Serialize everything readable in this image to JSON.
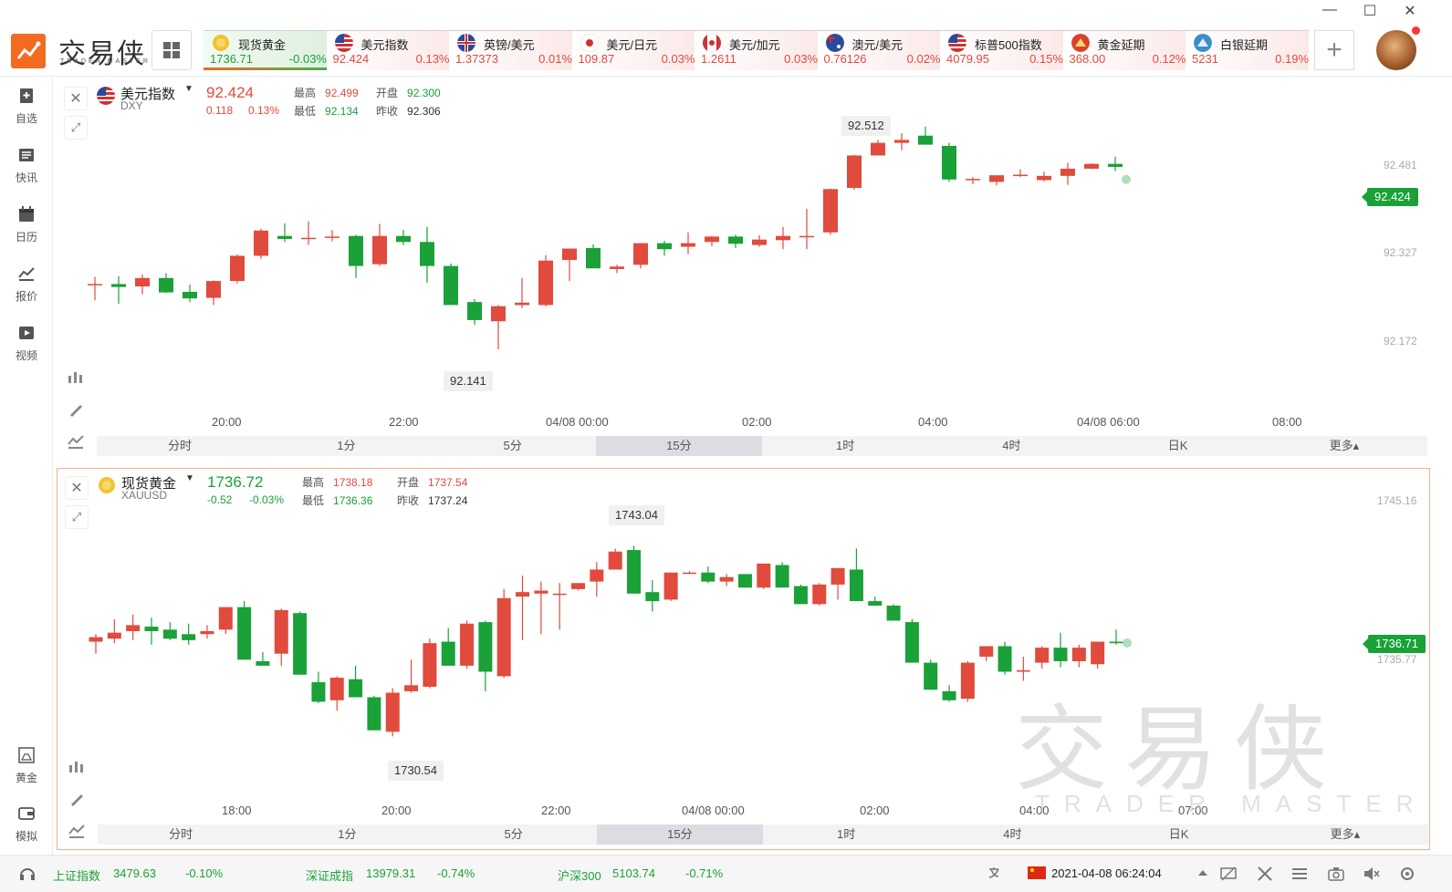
{
  "app": {
    "brand_cn": "交易侠",
    "brand_en": "TRADER MASTER",
    "win": {
      "min": "—",
      "max": "☐",
      "close": "✕"
    }
  },
  "tabs": [
    {
      "name": "现货黄金",
      "price": "1736.71",
      "pct": "-0.03%",
      "dir": "down",
      "flag": "gold-coin-icon"
    },
    {
      "name": "美元指数",
      "price": "92.424",
      "pct": "0.13%",
      "dir": "up",
      "flag": "us-flag-icon"
    },
    {
      "name": "英镑/美元",
      "price": "1.37373",
      "pct": "0.01%",
      "dir": "up",
      "flag": "uk-flag-icon"
    },
    {
      "name": "美元/日元",
      "price": "109.87",
      "pct": "0.03%",
      "dir": "up",
      "flag": "jp-flag-icon"
    },
    {
      "name": "美元/加元",
      "price": "1.2611",
      "pct": "0.03%",
      "dir": "up",
      "flag": "ca-flag-icon"
    },
    {
      "name": "澳元/美元",
      "price": "0.76126",
      "pct": "0.02%",
      "dir": "up",
      "flag": "au-flag-icon"
    },
    {
      "name": "标普500指数",
      "price": "4079.95",
      "pct": "0.15%",
      "dir": "up",
      "flag": "us-flag-icon"
    },
    {
      "name": "黄金延期",
      "price": "368.00",
      "pct": "0.12%",
      "dir": "up",
      "flag": "sge-gold-icon"
    },
    {
      "name": "白银延期",
      "price": "5231",
      "pct": "0.19%",
      "dir": "up",
      "flag": "sge-silver-icon"
    }
  ],
  "sidebar": [
    {
      "label": "自选",
      "icon": "bookmark-plus-icon"
    },
    {
      "label": "快讯",
      "icon": "news-list-icon"
    },
    {
      "label": "日历",
      "icon": "calendar-icon"
    },
    {
      "label": "报价",
      "icon": "line-chart-icon"
    },
    {
      "label": "视频",
      "icon": "video-play-icon"
    },
    {
      "label": "黄金",
      "icon": "gold-bars-icon"
    },
    {
      "label": "模拟",
      "icon": "wallet-icon"
    }
  ],
  "panel1": {
    "name": "美元指数",
    "code": "DXY",
    "price": "92.424",
    "chg": "0.118",
    "chgpct": "0.13%",
    "high_k": "最高",
    "high": "92.499",
    "open_k": "开盘",
    "open": "92.300",
    "low_k": "最低",
    "low": "92.134",
    "prev_k": "昨收",
    "prev": "92.306",
    "last_tag": "92.424",
    "yticks": [
      "92.481",
      "92.327",
      "92.172"
    ],
    "max_bubble": "92.512",
    "min_bubble": "92.141",
    "xticks": [
      "20:00",
      "22:00",
      "04/08 00:00",
      "02:00",
      "04:00",
      "04/08 06:00",
      "08:00"
    ]
  },
  "panel2": {
    "name": "现货黄金",
    "code": "XAUUSD",
    "price": "1736.72",
    "chg": "-0.52",
    "chgpct": "-0.03%",
    "high_k": "最高",
    "high": "1738.18",
    "open_k": "开盘",
    "open": "1737.54",
    "low_k": "最低",
    "low": "1736.36",
    "prev_k": "昨收",
    "prev": "1737.24",
    "last_tag": "1736.71",
    "yticks": [
      "1745.16",
      "1735.77"
    ],
    "max_bubble": "1743.04",
    "min_bubble": "1730.54",
    "xticks": [
      "18:00",
      "20:00",
      "22:00",
      "04/08 00:00",
      "02:00",
      "04:00",
      "07:00"
    ]
  },
  "timeframes": [
    "分时",
    "1分",
    "5分",
    "15分",
    "1时",
    "4时",
    "日K",
    "更多▴"
  ],
  "selected_timeframe": "15分",
  "watermark": {
    "cn": "交易侠",
    "en": "TRADER MASTER"
  },
  "status": {
    "idx1_name": "上证指数",
    "idx1_val": "3479.63",
    "idx1_pct": "-0.10%",
    "idx2_name": "深证成指",
    "idx2_val": "13979.31",
    "idx2_pct": "-0.74%",
    "idx3_name": "沪深300",
    "idx3_val": "5103.74",
    "idx3_pct": "-0.71%",
    "datetime": "2021-04-08 06:24:04"
  },
  "colors": {
    "up": "#e04b3d",
    "down": "#1aa138",
    "brand": "#f26b21"
  },
  "chart_data": [
    {
      "type": "candlestick",
      "title": "美元指数 DXY",
      "interval": "15分",
      "x": [
        "19:30",
        "19:45",
        "20:00",
        "20:15",
        "20:30",
        "20:45",
        "21:00",
        "21:15",
        "21:30",
        "21:45",
        "22:00",
        "22:15",
        "22:30",
        "22:45",
        "23:00",
        "23:15",
        "23:30",
        "23:45",
        "00:00",
        "00:15",
        "00:30",
        "00:45",
        "01:00",
        "01:15",
        "01:30",
        "01:45",
        "02:00",
        "02:15",
        "02:30",
        "02:45",
        "03:00",
        "03:15",
        "03:30",
        "03:45",
        "04:00",
        "04:15",
        "04:30",
        "04:45",
        "05:00",
        "05:15",
        "05:30",
        "05:45",
        "06:00",
        "06:15"
      ],
      "ohlc": [
        [
          92.249,
          92.262,
          92.223,
          92.25
        ],
        [
          92.25,
          92.263,
          92.217,
          92.245
        ],
        [
          92.246,
          92.266,
          92.233,
          92.26
        ],
        [
          92.26,
          92.268,
          92.235,
          92.236
        ],
        [
          92.237,
          92.249,
          92.22,
          92.226
        ],
        [
          92.227,
          92.256,
          92.215,
          92.255
        ],
        [
          92.255,
          92.299,
          92.251,
          92.297
        ],
        [
          92.297,
          92.342,
          92.292,
          92.339
        ],
        [
          92.33,
          92.351,
          92.32,
          92.325
        ],
        [
          92.326,
          92.354,
          92.315,
          92.327
        ],
        [
          92.329,
          92.34,
          92.321,
          92.329
        ],
        [
          92.33,
          92.332,
          92.26,
          92.28
        ],
        [
          92.283,
          92.35,
          92.28,
          92.33
        ],
        [
          92.33,
          92.34,
          92.315,
          92.32
        ],
        [
          92.32,
          92.345,
          92.252,
          92.28
        ],
        [
          92.28,
          92.284,
          92.219,
          92.215
        ],
        [
          92.22,
          92.225,
          92.182,
          92.19
        ],
        [
          92.188,
          92.215,
          92.141,
          92.213
        ],
        [
          92.215,
          92.26,
          92.21,
          92.219
        ],
        [
          92.215,
          92.298,
          92.213,
          92.289
        ],
        [
          92.29,
          92.298,
          92.255,
          92.309
        ],
        [
          92.31,
          92.316,
          92.279,
          92.276
        ],
        [
          92.275,
          92.282,
          92.268,
          92.279
        ],
        [
          92.282,
          92.318,
          92.276,
          92.318
        ],
        [
          92.318,
          92.322,
          92.297,
          92.308
        ],
        [
          92.312,
          92.336,
          92.3,
          92.318
        ],
        [
          92.32,
          92.33,
          92.313,
          92.329
        ],
        [
          92.329,
          92.332,
          92.31,
          92.317
        ],
        [
          92.315,
          92.331,
          92.312,
          92.324
        ],
        [
          92.323,
          92.345,
          92.308,
          92.33
        ],
        [
          92.33,
          92.375,
          92.308,
          92.33
        ],
        [
          92.336,
          92.409,
          92.332,
          92.408
        ],
        [
          92.41,
          92.465,
          92.407,
          92.464
        ],
        [
          92.464,
          92.49,
          92.469,
          92.485
        ],
        [
          92.485,
          92.501,
          92.473,
          92.49
        ],
        [
          92.497,
          92.512,
          92.486,
          92.482
        ],
        [
          92.48,
          92.485,
          92.42,
          92.424
        ],
        [
          92.423,
          92.428,
          92.416,
          92.425
        ],
        [
          92.42,
          92.43,
          92.414,
          92.431
        ],
        [
          92.43,
          92.441,
          92.428,
          92.432
        ],
        [
          92.423,
          92.437,
          92.421,
          92.43
        ],
        [
          92.43,
          92.452,
          92.415,
          92.442
        ],
        [
          92.442,
          92.451,
          92.441,
          92.45
        ],
        [
          92.45,
          92.462,
          92.438,
          92.445
        ]
      ],
      "ylim": [
        92.12,
        92.53
      ],
      "last_price": 92.424,
      "grid": false
    },
    {
      "type": "candlestick",
      "title": "现货黄金 XAUUSD",
      "interval": "15分",
      "x": [
        "17:30",
        "17:45",
        "18:00",
        "18:15",
        "18:30",
        "18:45",
        "19:00",
        "19:15",
        "19:30",
        "19:45",
        "20:00",
        "20:15",
        "20:30",
        "20:45",
        "21:00",
        "21:15",
        "21:30",
        "21:45",
        "22:00",
        "22:15",
        "22:30",
        "22:45",
        "23:00",
        "23:15",
        "23:30",
        "23:45",
        "00:00",
        "00:15",
        "00:30",
        "00:45",
        "01:00",
        "01:15",
        "01:30",
        "01:45",
        "02:00",
        "02:15",
        "02:30",
        "02:45",
        "03:00",
        "03:15",
        "03:30",
        "03:45",
        "04:00",
        "04:15",
        "04:30",
        "04:45",
        "05:00",
        "05:15",
        "05:30",
        "05:45",
        "06:00"
      ],
      "ohlc": [
        [
          1736.8,
          1737.3,
          1736.0,
          1737.1
        ],
        [
          1737.0,
          1738.3,
          1736.7,
          1737.4
        ],
        [
          1737.5,
          1738.6,
          1736.9,
          1737.9
        ],
        [
          1737.8,
          1738.4,
          1736.6,
          1737.5
        ],
        [
          1737.6,
          1738.1,
          1736.9,
          1737.0
        ],
        [
          1737.3,
          1738.0,
          1736.6,
          1736.9
        ],
        [
          1737.3,
          1737.9,
          1737.0,
          1737.5
        ],
        [
          1737.6,
          1739.1,
          1737.3,
          1739.1
        ],
        [
          1739.1,
          1739.5,
          1735.6,
          1735.6
        ],
        [
          1735.5,
          1736.1,
          1735.3,
          1735.2
        ],
        [
          1736.0,
          1739.0,
          1735.2,
          1738.9
        ],
        [
          1738.7,
          1738.8,
          1734.6,
          1734.6
        ],
        [
          1734.1,
          1734.8,
          1732.7,
          1732.8
        ],
        [
          1732.9,
          1734.5,
          1732.2,
          1734.4
        ],
        [
          1734.3,
          1735.2,
          1733.2,
          1733.1
        ],
        [
          1733.1,
          1733.2,
          1730.9,
          1730.9
        ],
        [
          1730.8,
          1733.7,
          1730.5,
          1733.4
        ],
        [
          1733.5,
          1735.6,
          1733.4,
          1733.9
        ],
        [
          1733.8,
          1737.0,
          1733.7,
          1736.7
        ],
        [
          1736.8,
          1737.7,
          1735.2,
          1735.2
        ],
        [
          1735.2,
          1738.2,
          1735.0,
          1738.0
        ],
        [
          1738.1,
          1738.2,
          1733.5,
          1734.8
        ],
        [
          1734.5,
          1740.3,
          1734.4,
          1739.7
        ],
        [
          1739.8,
          1741.2,
          1736.9,
          1740.1
        ],
        [
          1740.0,
          1740.8,
          1737.3,
          1740.2
        ],
        [
          1740.0,
          1740.7,
          1737.6,
          1740.0
        ],
        [
          1740.3,
          1740.3,
          1740.2,
          1740.7
        ],
        [
          1740.8,
          1742.1,
          1739.8,
          1741.6
        ],
        [
          1741.6,
          1743.0,
          1741.6,
          1742.8
        ],
        [
          1742.9,
          1743.2,
          1740.0,
          1740.0
        ],
        [
          1740.1,
          1740.9,
          1738.8,
          1739.5
        ],
        [
          1739.6,
          1741.4,
          1739.5,
          1741.4
        ],
        [
          1741.4,
          1741.5,
          1741.3,
          1741.4
        ],
        [
          1741.4,
          1741.8,
          1740.7,
          1740.8
        ],
        [
          1740.8,
          1741.3,
          1740.5,
          1741.1
        ],
        [
          1741.3,
          1741.3,
          1740.4,
          1740.4
        ],
        [
          1740.4,
          1742.0,
          1740.3,
          1742.0
        ],
        [
          1741.9,
          1742.1,
          1740.4,
          1740.4
        ],
        [
          1740.5,
          1740.6,
          1739.3,
          1739.3
        ],
        [
          1739.3,
          1740.7,
          1739.2,
          1740.6
        ],
        [
          1740.6,
          1741.7,
          1739.6,
          1741.7
        ],
        [
          1741.6,
          1743.0,
          1739.5,
          1739.5
        ],
        [
          1739.5,
          1739.8,
          1739.2,
          1739.2
        ],
        [
          1739.2,
          1739.3,
          1738.2,
          1738.2
        ],
        [
          1738.1,
          1738.3,
          1735.5,
          1735.4
        ],
        [
          1735.4,
          1735.6,
          1733.6,
          1733.6
        ],
        [
          1733.5,
          1733.9,
          1732.8,
          1732.9
        ],
        [
          1733.0,
          1735.5,
          1732.8,
          1735.4
        ],
        [
          1735.8,
          1736.4,
          1735.5,
          1736.5
        ],
        [
          1736.5,
          1736.8,
          1734.6,
          1734.8
        ],
        [
          1734.8,
          1735.8,
          1734.2,
          1734.9
        ],
        [
          1735.4,
          1736.5,
          1735.0,
          1736.4
        ],
        [
          1736.4,
          1737.4,
          1735.1,
          1735.5
        ],
        [
          1735.5,
          1736.6,
          1735.1,
          1736.4
        ],
        [
          1735.3,
          1736.8,
          1735.0,
          1736.8
        ],
        [
          1736.8,
          1737.6,
          1736.6,
          1736.7
        ]
      ],
      "ylim": [
        1729.0,
        1746.0
      ],
      "last_price": 1736.71,
      "grid": false
    }
  ]
}
